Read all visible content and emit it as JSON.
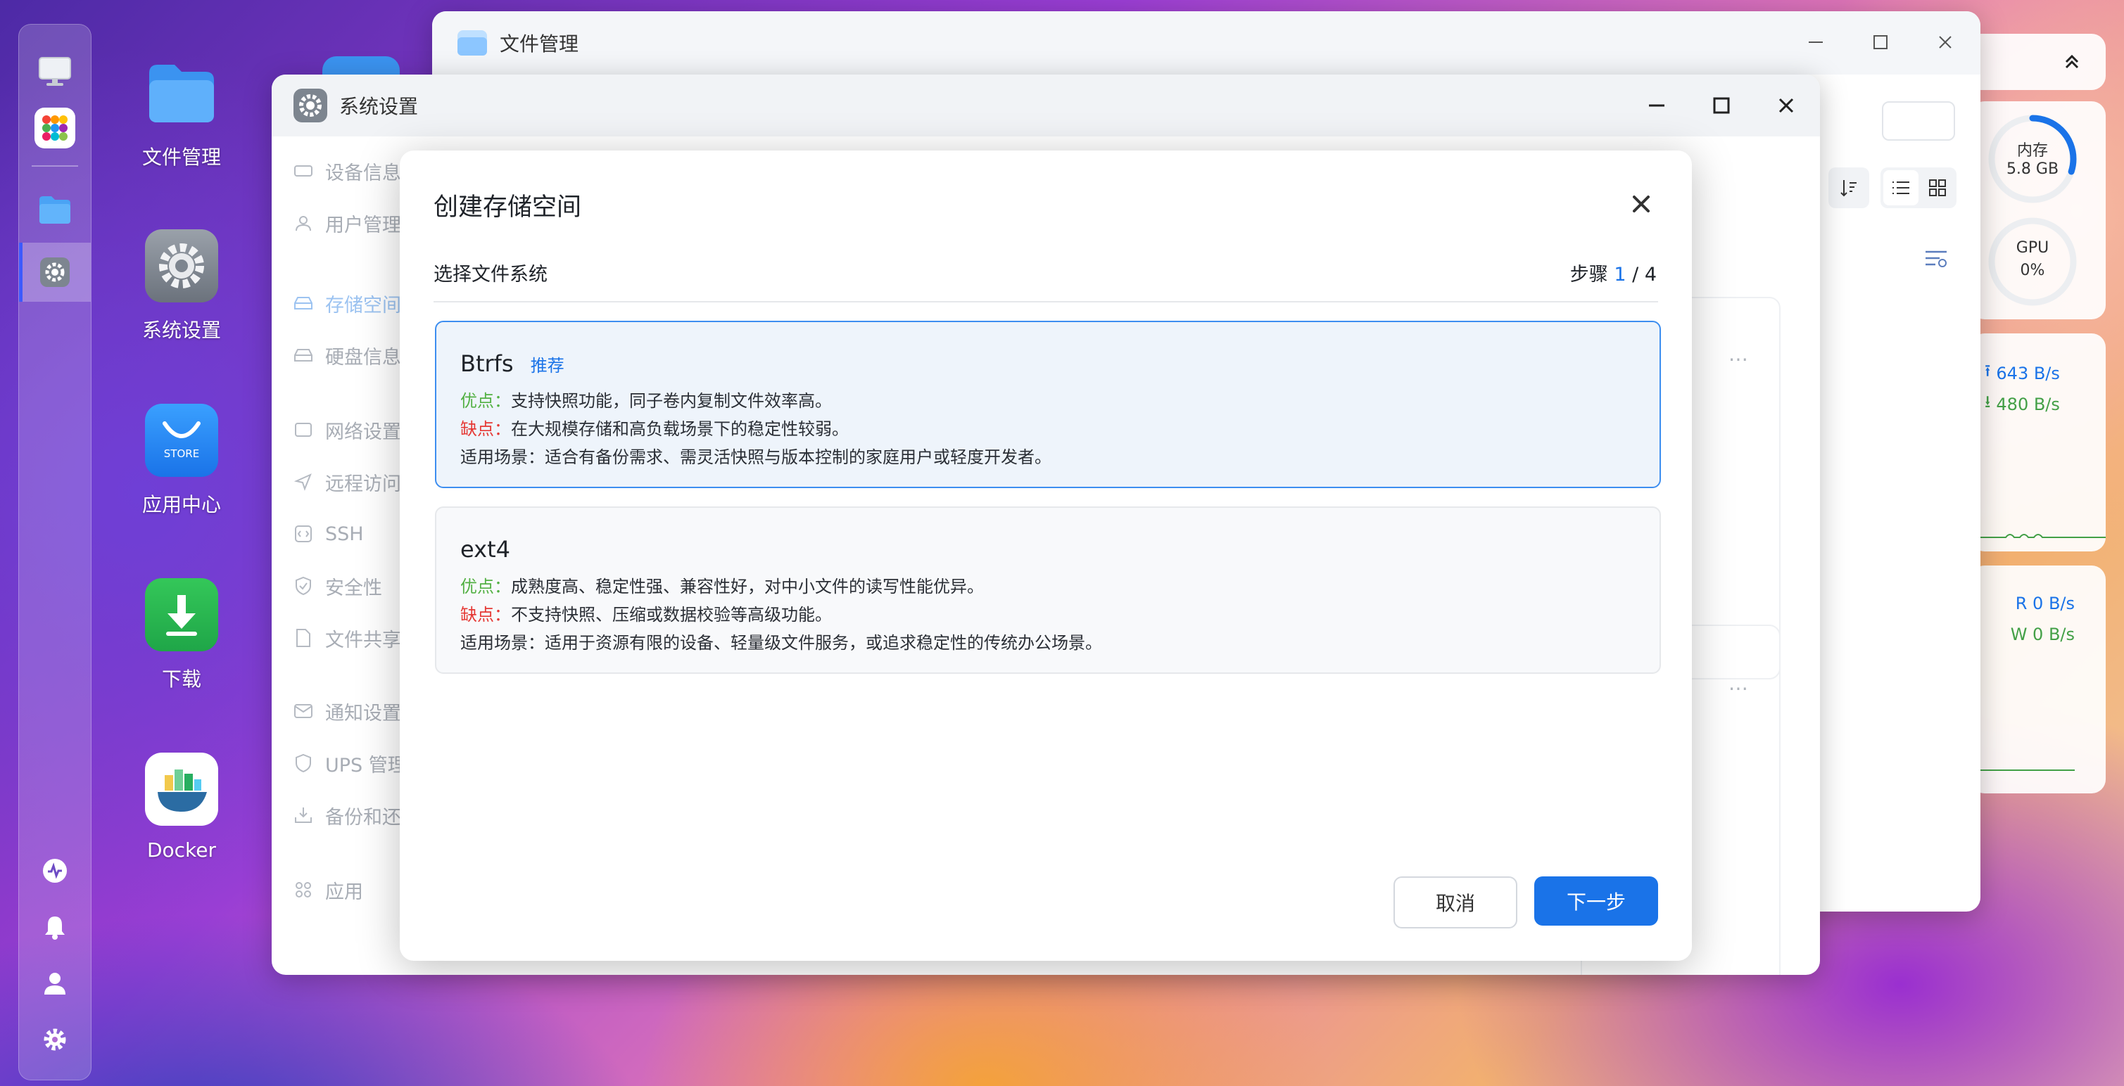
{
  "desktop": {
    "icons": [
      {
        "label": "文件管理",
        "icon": "folder-icon"
      },
      {
        "label": "系统设置",
        "icon": "gear-icon"
      },
      {
        "label": "应用中心",
        "icon": "store-icon",
        "badge": "STORE"
      },
      {
        "label": "下载",
        "icon": "download-icon"
      },
      {
        "label": "Docker",
        "icon": "docker-icon"
      }
    ]
  },
  "file_window": {
    "title": "文件管理"
  },
  "settings_window": {
    "title": "系统设置",
    "sidebar": [
      {
        "label": "设备信息",
        "icon": "drive-icon"
      },
      {
        "label": "用户管理",
        "icon": "user-icon"
      },
      {
        "label": "存储空间",
        "icon": "storage-icon"
      },
      {
        "label": "硬盘信息",
        "icon": "disk-icon"
      },
      {
        "label": "网络设置",
        "icon": "network-icon"
      },
      {
        "label": "远程访问",
        "icon": "send-icon"
      },
      {
        "label": "SSH",
        "icon": "code-icon"
      },
      {
        "label": "安全性",
        "icon": "shield-check-icon"
      },
      {
        "label": "文件共享",
        "icon": "file-icon"
      },
      {
        "label": "通知设置",
        "icon": "mail-icon"
      },
      {
        "label": "UPS 管理",
        "icon": "shield-icon"
      },
      {
        "label": "备份和还原",
        "icon": "backup-icon"
      },
      {
        "label": "应用",
        "icon": "apps-icon"
      }
    ]
  },
  "modal": {
    "title": "创建存储空间",
    "subtitle": "选择文件系统",
    "step_label": "步骤",
    "step_current": "1",
    "step_sep": " / ",
    "step_total": "4",
    "options": [
      {
        "name": "Btrfs",
        "tag": "推荐",
        "pros_label": "优点：",
        "pros": "支持快照功能，同子卷内复制文件效率高。",
        "cons_label": "缺点：",
        "cons": "在大规模存储和高负载场景下的稳定性较弱。",
        "scene_label": "适用场景：",
        "scene": "适合有备份需求、需灵活快照与版本控制的家庭用户或轻度开发者。",
        "selected": true
      },
      {
        "name": "ext4",
        "tag": "",
        "pros_label": "优点：",
        "pros": "成熟度高、稳定性强、兼容性好，对中小文件的读写性能优异。",
        "cons_label": "缺点：",
        "cons": "不支持快照、压缩或数据校验等高级功能。",
        "scene_label": "适用场景：",
        "scene": "适用于资源有限的设备、轻量级文件服务，或追求稳定性的传统办公场景。",
        "selected": false
      }
    ],
    "cancel": "取消",
    "next": "下一步"
  },
  "widgets": {
    "memory_label": "内存",
    "memory_value": "5.8 GB",
    "memory_usage_fraction": 0.3,
    "gpu_label": "GPU",
    "gpu_value": "0%",
    "upload": "643 B/s",
    "download": "480 B/s",
    "read": "R  0 B/s",
    "write": "W  0 B/s"
  },
  "colors": {
    "accent": "#1a73e8",
    "selected_bg": "#eef4fb",
    "pro": "#52b043",
    "con": "#e53935"
  }
}
